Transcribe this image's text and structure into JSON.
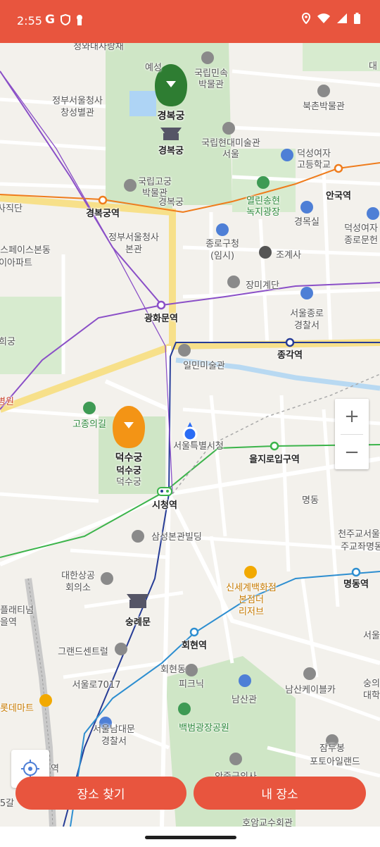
{
  "status_bar": {
    "time": "2:55",
    "left_icons": [
      "google-icon",
      "shield-icon",
      "keyhole-icon"
    ],
    "right_icons": [
      "location-icon",
      "wifi-icon",
      "signal-icon",
      "battery-icon"
    ]
  },
  "map": {
    "markers": [
      {
        "label": "경복궁",
        "color": "#2e7d32"
      },
      {
        "label": "덕수궁",
        "color": "#f39415"
      }
    ],
    "labels": [
      {
        "text": "청와대사랑채"
      },
      {
        "text": "예성"
      },
      {
        "text": "국립민속"
      },
      {
        "text": "박물관"
      },
      {
        "text": "정부서울청사"
      },
      {
        "text": "창성별관"
      },
      {
        "text": "경복궁"
      },
      {
        "text": "경복궁"
      },
      {
        "text": "북촌박물관"
      },
      {
        "text": "국립현대미술관"
      },
      {
        "text": "서울"
      },
      {
        "text": "덕성여자"
      },
      {
        "text": "고등학교"
      },
      {
        "text": "대"
      },
      {
        "text": "국립고궁"
      },
      {
        "text": "박물관"
      },
      {
        "text": "열린송현"
      },
      {
        "text": "녹지광장"
      },
      {
        "text": "안국역"
      },
      {
        "text": "사직단"
      },
      {
        "text": "경복궁역"
      },
      {
        "text": "경목실"
      },
      {
        "text": "덕성여자"
      },
      {
        "text": "종로문헌"
      },
      {
        "text": "정부서울청사"
      },
      {
        "text": "본관"
      },
      {
        "text": "종로구청"
      },
      {
        "text": "(임시)"
      },
      {
        "text": "조계사"
      },
      {
        "text": "스페이스본동"
      },
      {
        "text": "이아파트"
      },
      {
        "text": "장미계단"
      },
      {
        "text": "광화문역"
      },
      {
        "text": "서울종로"
      },
      {
        "text": "경찰서"
      },
      {
        "text": "희궁"
      },
      {
        "text": "종각역"
      },
      {
        "text": "일민미술관"
      },
      {
        "text": "병원"
      },
      {
        "text": "고종의길"
      },
      {
        "text": "서울특별시청"
      },
      {
        "text": "덕수궁"
      },
      {
        "text": "덕수궁"
      },
      {
        "text": "을지로입구역"
      },
      {
        "text": "명동"
      },
      {
        "text": "시청역"
      },
      {
        "text": "천주교서울"
      },
      {
        "text": "주교좌명동"
      },
      {
        "text": "삼성본관빌딩"
      },
      {
        "text": "대한상공"
      },
      {
        "text": "회의소"
      },
      {
        "text": "명동역"
      },
      {
        "text": "신세계백화점"
      },
      {
        "text": "본점더"
      },
      {
        "text": "리저브"
      },
      {
        "text": "플래티넘"
      },
      {
        "text": "을역"
      },
      {
        "text": "숭례문"
      },
      {
        "text": "서울"
      },
      {
        "text": "그랜드센트럴"
      },
      {
        "text": "회현역"
      },
      {
        "text": "회현동"
      },
      {
        "text": "피크닉"
      },
      {
        "text": "서울로7017"
      },
      {
        "text": "남산관"
      },
      {
        "text": "남산케이블카"
      },
      {
        "text": "숭의"
      },
      {
        "text": "대학"
      },
      {
        "text": "롯데마트"
      },
      {
        "text": "서울남대문"
      },
      {
        "text": "경찰서"
      },
      {
        "text": "백범광장공원"
      },
      {
        "text": "잠두봉"
      },
      {
        "text": "포토아일랜드"
      },
      {
        "text": "역"
      },
      {
        "text": "안중근의사"
      },
      {
        "text": "5갈"
      },
      {
        "text": "호암교수회관"
      }
    ]
  },
  "zoom": {
    "in": "+",
    "out": "−"
  },
  "buttons": {
    "find_place": "장소 찾기",
    "my_places": "내 장소"
  },
  "colors": {
    "accent": "#e8553e",
    "line_purple": "#8a4fc7",
    "line_green": "#3cb44b",
    "line_navy": "#263c96",
    "line_orange": "#ef7c1c",
    "line_blue": "#2d8ed0"
  }
}
